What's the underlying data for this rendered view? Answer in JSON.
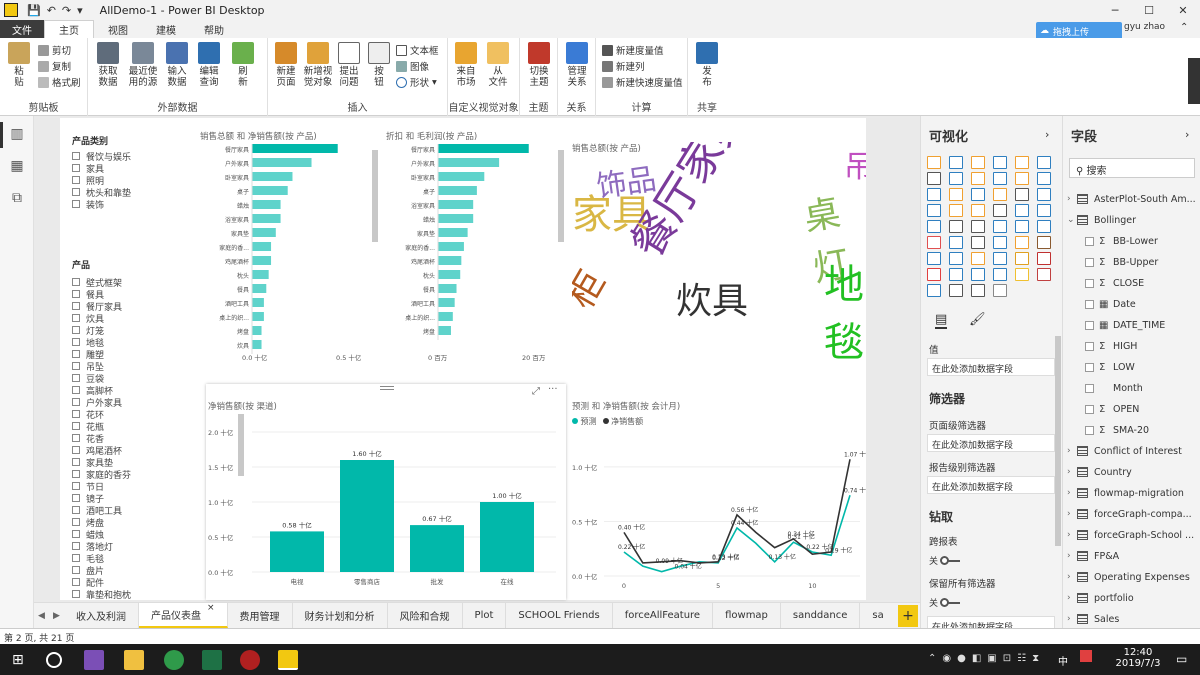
{
  "window": {
    "title": "AllDemo-1 - Power BI Desktop",
    "user": "gyu zhao",
    "upload_label": "拖拽上传"
  },
  "ribbon_tabs": [
    "文件",
    "主页",
    "视图",
    "建模",
    "帮助"
  ],
  "ribbon": {
    "clipboard": {
      "paste": "粘\n贴",
      "cut": "剪切",
      "copy": "复制",
      "format_painter": "格式刷",
      "label": "剪贴板"
    },
    "external": {
      "get_data": "获取\n数据",
      "recent": "最近使\n用的源",
      "enter": "输入\n数据",
      "edit": "编辑\n查询",
      "refresh": "刷\n新",
      "label": "外部数据"
    },
    "insert": {
      "new_page": "新建\n页面",
      "new_visual": "新增视\n觉对象",
      "ask": "提出\n问题",
      "button": "按\n钮",
      "textbox": "文本框",
      "image": "图像",
      "shape": "形状",
      "label": "插入"
    },
    "custom": {
      "market": "来自\n市场",
      "file": "从\n文件",
      "label": "自定义视觉对象"
    },
    "theme": {
      "switch": "切换\n主题",
      "label": "主题"
    },
    "relations": {
      "manage": "管理\n关系",
      "label": "关系"
    },
    "calc": {
      "new_measure": "新建度量值",
      "new_column": "新建列",
      "new_quick": "新建快速度量值",
      "label": "计算"
    },
    "share": {
      "publish": "发\n布",
      "label": "共享"
    }
  },
  "slicer_category": {
    "title": "产品类别",
    "items": [
      "餐饮与娱乐",
      "家具",
      "照明",
      "枕头和靠垫",
      "装饰"
    ]
  },
  "slicer_product": {
    "title": "产品",
    "items": [
      "壁式框架",
      "餐具",
      "餐厅家具",
      "炊具",
      "灯笼",
      "地毯",
      "雕塑",
      "吊坠",
      "豆袋",
      "高脚杯",
      "户外家具",
      "花环",
      "花瓶",
      "花香",
      "鸡尾酒杯",
      "家具垫",
      "家庭的香芬",
      "节日",
      "镜子",
      "酒吧工具",
      "烤盘",
      "蜡烛",
      "落地灯",
      "毛毯",
      "盘片",
      "配件",
      "靠垫和抱枕"
    ]
  },
  "bar1": {
    "title": "销售总额 和 净销售额(按 产品)",
    "categories": [
      "餐厅家具",
      "户外家具",
      "卧室家具",
      "桌子",
      "蜡烛",
      "浴室家具",
      "家具垫",
      "家庭的香...",
      "鸡尾酒杯",
      "枕头",
      "餐具",
      "酒吧工具",
      "桌上的织...",
      "烤盘",
      "炊具"
    ],
    "values": [
      0.36,
      0.25,
      0.17,
      0.15,
      0.12,
      0.12,
      0.1,
      0.08,
      0.08,
      0.07,
      0.06,
      0.05,
      0.05,
      0.04,
      0.04
    ],
    "axis": [
      "0.0 十亿",
      "0.5 十亿"
    ]
  },
  "bar2": {
    "title": "折扣 和 毛利润(按 产品)",
    "categories": [
      "餐厅家具",
      "户外家具",
      "卧室家具",
      "桌子",
      "浴室家具",
      "蜡烛",
      "家具垫",
      "家庭的香...",
      "鸡尾酒杯",
      "枕头",
      "餐具",
      "酒吧工具",
      "桌上的织...",
      "烤盘"
    ],
    "values": [
      24.5,
      16.5,
      12.5,
      10.5,
      9.5,
      9.5,
      8,
      7,
      6.3,
      6,
      5,
      4.5,
      4,
      3.5
    ],
    "axis": [
      "0 百万",
      "20 百万"
    ]
  },
  "wordcloud": {
    "title": "销售总额(按 产品)",
    "words": [
      "饰品",
      "家具",
      "餐厅家具",
      "炊具",
      "柜",
      "桌灯",
      "地毯",
      "吊"
    ]
  },
  "chart_data": [
    {
      "type": "bar",
      "title": "净销售额(按 渠道)",
      "categories": [
        "电视",
        "零售商店",
        "批发",
        "在线"
      ],
      "values": [
        0.58,
        1.6,
        0.67,
        1.0
      ],
      "data_labels": [
        "0.58 十亿",
        "1.60 十亿",
        "0.67 十亿",
        "1.00 十亿"
      ],
      "ylim": [
        0,
        2
      ],
      "yticks": [
        "0.0 十亿",
        "0.5 十亿",
        "1.0 十亿",
        "1.5 十亿",
        "2.0 十亿"
      ]
    },
    {
      "type": "line",
      "title": "预测 和 净销售额(按 会计月)",
      "series": [
        {
          "name": "预测",
          "color": "#01b8aa",
          "values": [
            0.22,
            0.09,
            0.04,
            0.09,
            0.13,
            0.12,
            0.44,
            0.3,
            0.13,
            0.31,
            0.22,
            0.19,
            0.74
          ]
        },
        {
          "name": "净销售额",
          "color": "#333333",
          "values": [
            0.4,
            0.12,
            0.13,
            0.14,
            0.12,
            0.13,
            0.56,
            0.4,
            0.26,
            0.34,
            0.2,
            0.22,
            1.07
          ]
        }
      ],
      "labels": [
        "0.40 十亿",
        "0.22 十亿",
        "0.09 十亿",
        "0.04 十亿",
        "0.13 十亿",
        "0.12 十亿",
        "0.56 十亿",
        "0.44 十亿",
        "0.13 十亿",
        "0.34 十亿",
        "0.31 十亿",
        "0.22 十亿",
        "0.19 十亿",
        "0.74 十亿",
        "1.07 十亿"
      ],
      "xticks": [
        "0",
        "5",
        "10"
      ],
      "yticks": [
        "0.0 十亿",
        "0.5 十亿",
        "1.0 十亿"
      ],
      "ylim": [
        0,
        1.1
      ]
    }
  ],
  "page_tabs": [
    "收入及利润",
    "产品仪表盘",
    "费用管理",
    "财务计划和分析",
    "风险和合规",
    "Plot",
    "SCHOOL Friends",
    "forceAllFeature",
    "flowmap",
    "sanddance",
    "sa"
  ],
  "active_tab": 1,
  "status": "第 2 页, 共 21 页",
  "viz_pane": {
    "title": "可视化",
    "values_label": "值",
    "add_field": "在此处添加数据字段",
    "filters": "筛选器",
    "page_filters": "页面级筛选器",
    "report_filters": "报告级别筛选器",
    "drill": "钻取",
    "cross_report": "跨报表",
    "off": "关",
    "keep_filters": "保留所有筛选器"
  },
  "field_pane": {
    "title": "字段",
    "search": "搜索"
  },
  "fields": [
    {
      "kind": "table",
      "label": "AsterPlot-South Am...",
      "open": false
    },
    {
      "kind": "table",
      "label": "Bollinger",
      "open": true
    },
    {
      "kind": "sum",
      "label": "BB-Lower"
    },
    {
      "kind": "sum",
      "label": "BB-Upper"
    },
    {
      "kind": "sum",
      "label": "CLOSE"
    },
    {
      "kind": "date",
      "label": "Date"
    },
    {
      "kind": "date",
      "label": "DATE_TIME"
    },
    {
      "kind": "sum",
      "label": "HIGH"
    },
    {
      "kind": "sum",
      "label": "LOW"
    },
    {
      "kind": "plain",
      "label": "Month"
    },
    {
      "kind": "sum",
      "label": "OPEN"
    },
    {
      "kind": "sum",
      "label": "SMA-20"
    },
    {
      "kind": "table",
      "label": "Conflict of Interest",
      "open": false
    },
    {
      "kind": "table",
      "label": "Country",
      "open": false
    },
    {
      "kind": "table",
      "label": "flowmap-migration",
      "open": false
    },
    {
      "kind": "table",
      "label": "forceGraph-compa...",
      "open": false
    },
    {
      "kind": "table",
      "label": "forceGraph-School ...",
      "open": false
    },
    {
      "kind": "table",
      "label": "FP&A",
      "open": false
    },
    {
      "kind": "table",
      "label": "Operating Expenses",
      "open": false
    },
    {
      "kind": "table",
      "label": "portfolio",
      "open": false
    },
    {
      "kind": "table",
      "label": "Sales",
      "open": false
    },
    {
      "kind": "table",
      "label": "SalesVsExpense",
      "open": false
    }
  ],
  "taskbar": {
    "time": "12:40",
    "date": "2019/7/3",
    "lang": "中"
  }
}
